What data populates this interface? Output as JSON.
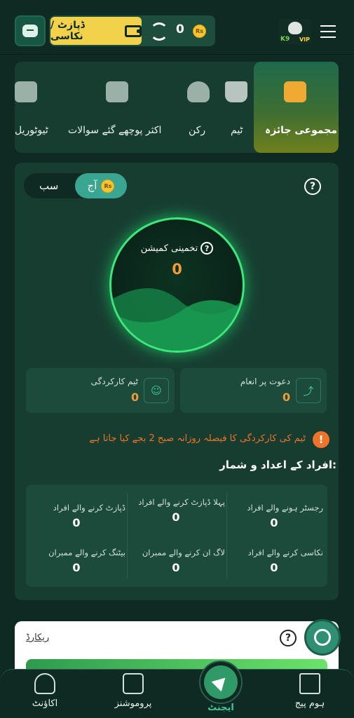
{
  "header": {
    "deposit_withdraw_label": "ڈپازٹ / نکاسی",
    "balance": "0",
    "currency": "Rs",
    "logo_text_left": "K9",
    "logo_text_right": "VIP"
  },
  "tabs": [
    {
      "label": "مجموعی جائزہ",
      "icon": "overview-chart-icon",
      "active": true
    },
    {
      "label": "ٹیم",
      "icon": "crown-icon"
    },
    {
      "label": "رکن",
      "icon": "members-icon"
    },
    {
      "label": "اکثر پوچھے گئے سوالات",
      "icon": "faq-icon"
    },
    {
      "label": "ٹیوٹوریل",
      "icon": "tutorial-icon"
    }
  ],
  "period": {
    "today": "آج",
    "all": "سب",
    "coin": "Rs"
  },
  "commission": {
    "title": "تخمینی کمیشن",
    "value": "0"
  },
  "cards": {
    "invite_reward_label": "دعوت پر انعام",
    "invite_reward_value": "0",
    "team_performance_label": "ٹیم کارکردگی",
    "team_performance_value": "0"
  },
  "notice": "ٹیم کی کارکردگی کا فیصلہ روزانہ صبح 2 بجے کیا جاتا ہے",
  "stats": {
    "title": "افراد کے اعداد و شمار:",
    "items": [
      {
        "label": "رجسٹر ہونے والے افراد",
        "value": "0"
      },
      {
        "label": "پہلا ڈپازٹ کرنے والے افراد",
        "value": "0"
      },
      {
        "label": "ڈپازٹ کرنے والے افراد",
        "value": "0"
      },
      {
        "label": "نکاسی کرنے والے افراد",
        "value": "0"
      },
      {
        "label": "لاگ ان کرنے والے ممبران",
        "value": "0"
      },
      {
        "label": "بیٹنگ کرنے والے ممبران",
        "value": "0"
      }
    ]
  },
  "records": {
    "link": "ریکارڈ"
  },
  "nav": {
    "home": "ہوم پیج",
    "agent": "ایجنٹ",
    "promotions": "پروموشنز",
    "account": "اکاؤنٹ"
  },
  "colors": {
    "background": "#0f2a22",
    "panel": "#173d31",
    "accent_green": "#3ee77b",
    "value_orange": "#f39b3a",
    "deposit_yellow": "#f2d24b",
    "warning": "#ef7328"
  }
}
